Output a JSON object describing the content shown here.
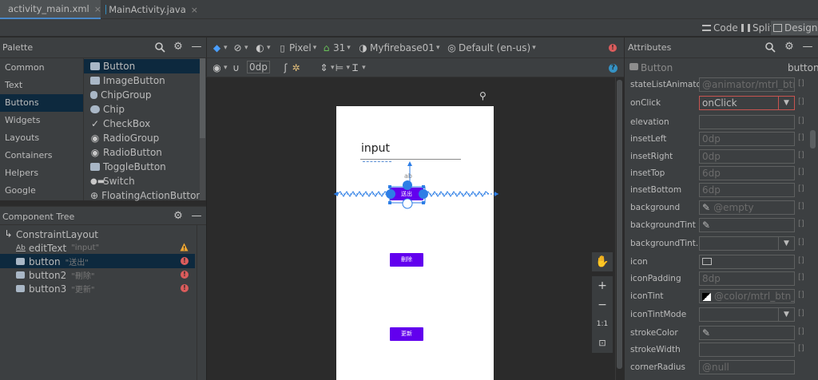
{
  "tabs": [
    {
      "label": "activity_main.xml",
      "close": "×"
    },
    {
      "label": "MainActivity.java",
      "close": "×"
    }
  ],
  "modes": {
    "code": "Code",
    "split": "Split",
    "design": "Design"
  },
  "palette": {
    "title": "Palette",
    "categories": [
      "Common",
      "Text",
      "Buttons",
      "Widgets",
      "Layouts",
      "Containers",
      "Helpers",
      "Google"
    ],
    "selected_category": "Buttons",
    "widgets": [
      "Button",
      "ImageButton",
      "ChipGroup",
      "Chip",
      "CheckBox",
      "RadioGroup",
      "RadioButton",
      "ToggleButton",
      "Switch",
      "FloatingActionButton"
    ]
  },
  "toolbar": {
    "device": "Pixel",
    "api": "31",
    "app": "Myfirebase01",
    "locale": "Default (en-us)",
    "margin": "0dp"
  },
  "component_tree": {
    "title": "Component Tree",
    "root": "ConstraintLayout",
    "nodes": [
      {
        "name": "editText",
        "hint": "\"input\""
      },
      {
        "name": "button",
        "hint": "\"送出\""
      },
      {
        "name": "button2",
        "hint": "\"刪除\""
      },
      {
        "name": "button3",
        "hint": "\"更新\""
      }
    ]
  },
  "phone": {
    "edit_hint": "input",
    "buttons": [
      "送出",
      "刪除",
      "更新"
    ],
    "accent": "#6200ee"
  },
  "attributes": {
    "title": "Attributes",
    "widget_type": "Button",
    "widget_id": "button",
    "rows": [
      {
        "label": "stateListAnimator",
        "value": "@animator/mtrl_btn_s"
      },
      {
        "label": "onClick",
        "value": "onClick"
      },
      {
        "label": "elevation",
        "value": ""
      },
      {
        "label": "insetLeft",
        "value": "0dp"
      },
      {
        "label": "insetRight",
        "value": "0dp"
      },
      {
        "label": "insetTop",
        "value": "6dp"
      },
      {
        "label": "insetBottom",
        "value": "6dp"
      },
      {
        "label": "background",
        "value": "@empty"
      },
      {
        "label": "backgroundTint",
        "value": ""
      },
      {
        "label": "backgroundTint...",
        "value": ""
      },
      {
        "label": "icon",
        "value": ""
      },
      {
        "label": "iconPadding",
        "value": "8dp"
      },
      {
        "label": "iconTint",
        "value": "@color/mtrl_btn_te"
      },
      {
        "label": "iconTintMode",
        "value": ""
      },
      {
        "label": "strokeColor",
        "value": ""
      },
      {
        "label": "strokeWidth",
        "value": ""
      },
      {
        "label": "cornerRadius",
        "value": "@null"
      }
    ]
  },
  "zoom": {
    "plus": "+",
    "minus": "−",
    "one_to_one": "1:1"
  }
}
